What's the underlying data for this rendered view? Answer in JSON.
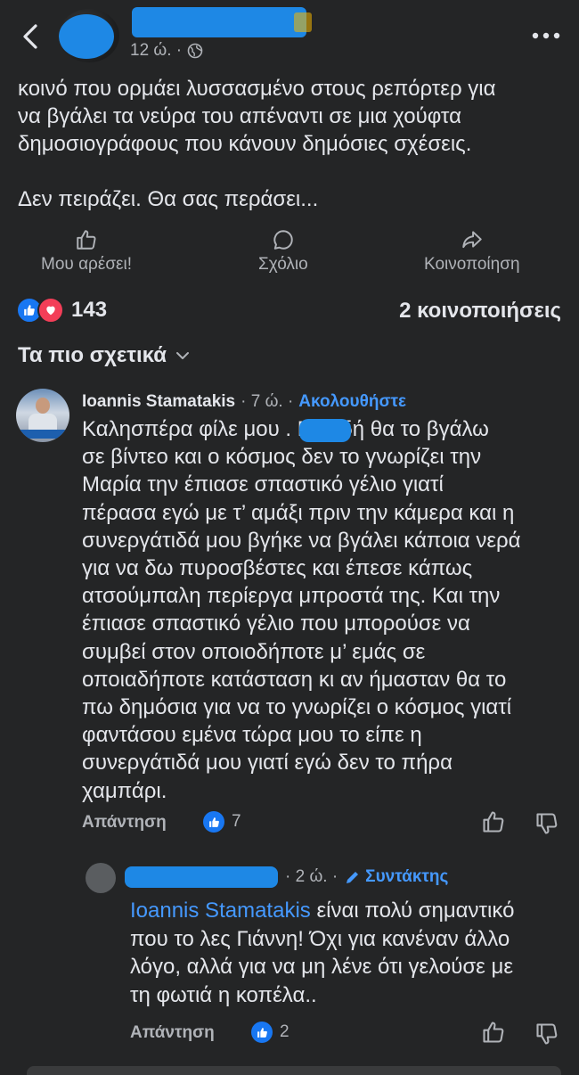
{
  "header": {
    "time_ago": "12 ώ. ·",
    "back_icon": "chevron-left-icon",
    "globe_icon": "globe-icon",
    "more_icon": "more-horizontal-icon"
  },
  "post": {
    "text": "κοινό που ορμάει λυσσασμένο στους ρεπόρτερ για\nνα βγάλει τα νεύρα του απέναντι σε μια χούφτα\nδημοσιογράφους που κάνουν δημόσιες σχέσεις.\n\nΔεν πειράζει. Θα σας περάσει..."
  },
  "actions": {
    "like": "Μου αρέσει!",
    "comment": "Σχόλιο",
    "share": "Κοινοποίηση"
  },
  "stats": {
    "reactions_count": "143",
    "shares": "2 κοινοποιήσεις"
  },
  "sort": {
    "label": "Τα πιο σχετικά"
  },
  "comment1": {
    "author": "Ioannis Stamatakis",
    "time": "· 7 ώ. ·",
    "follow": "Ακολουθήστε",
    "text": "Καλησπέρα φίλε μου        . Επειδή θα το βγάλω\nσε βίντεο και ο κόσμος δεν το γνωρίζει την\nΜαρία την έπιασε σπαστικό γέλιο γιατί\nπέρασα εγώ με τ’ αμάξι πριν την κάμερα και η\nσυνεργάτιδά μου βγήκε να βγάλει κάποια νερά\nγια να δω πυροσβέστες και έπεσε κάπως\nατσούμπαλη περίεργα μπροστά της. Και την\nέπιασε σπαστικό γέλιο που μπορούσε να\nσυμβεί στον οποιοδήποτε μ’ εμάς σε\nοποιαδήποτε κατάσταση κι αν ήμασταν θα το\nπω δημόσια για να το γνωρίζει ο κόσμος γιατί\nφαντάσου εμένα τώρα μου το είπε η\nσυνεργάτιδά μου γιατί εγώ δεν το πήρα\nχαμπάρι.",
    "reply_label": "Απάντηση",
    "likes": "7"
  },
  "reply1": {
    "time": "· 2 ώ. ·",
    "badge": "Συντάκτης",
    "mention": "Ioannis Stamatakis",
    "text_first": " είναι πολύ σημαντικό",
    "text_rest": "που το λες Γιάννη! Όχι για κανέναν άλλο\nλόγο, αλλά για να μη λένε ότι γελούσε με\nτη φωτιά η κοπέλα..",
    "reply_label": "Απάντηση",
    "likes": "2"
  },
  "colors": {
    "background": "#242526",
    "text": "#e4e6eb",
    "secondary": "#b0b3b8",
    "link": "#4599ff",
    "like_blue": "#1877f2",
    "love_red": "#f33e58"
  }
}
